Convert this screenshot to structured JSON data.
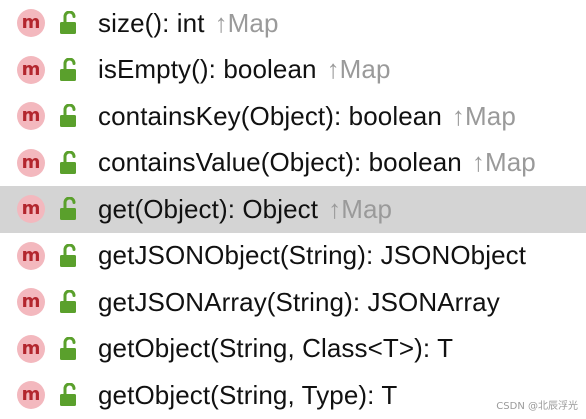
{
  "members": [
    {
      "badge": "m",
      "icon": "open-lock-icon",
      "signature": "size(): int",
      "arrow": "↑",
      "owner": "Map",
      "selected": false
    },
    {
      "badge": "m",
      "icon": "open-lock-icon",
      "signature": "isEmpty(): boolean",
      "arrow": "↑",
      "owner": "Map",
      "selected": false
    },
    {
      "badge": "m",
      "icon": "open-lock-icon",
      "signature": "containsKey(Object): boolean",
      "arrow": "↑",
      "owner": "Map",
      "selected": false
    },
    {
      "badge": "m",
      "icon": "open-lock-icon",
      "signature": "containsValue(Object): boolean",
      "arrow": "↑",
      "owner": "Map",
      "selected": false
    },
    {
      "badge": "m",
      "icon": "open-lock-icon",
      "signature": "get(Object): Object",
      "arrow": "↑",
      "owner": "Map",
      "selected": true
    },
    {
      "badge": "m",
      "icon": "open-lock-icon",
      "signature": "getJSONObject(String): JSONObject",
      "arrow": "",
      "owner": "",
      "selected": false
    },
    {
      "badge": "m",
      "icon": "open-lock-icon",
      "signature": "getJSONArray(String): JSONArray",
      "arrow": "",
      "owner": "",
      "selected": false
    },
    {
      "badge": "m",
      "icon": "open-lock-icon",
      "signature": "getObject(String, Class<T>): T",
      "arrow": "",
      "owner": "",
      "selected": false
    },
    {
      "badge": "m",
      "icon": "open-lock-icon",
      "signature": "getObject(String, Type): T",
      "arrow": "",
      "owner": "",
      "selected": false
    }
  ],
  "watermark": "CSDN @北辰浮光",
  "colors": {
    "badge_bg": "#f3b8be",
    "badge_fg": "#b3262e",
    "lock": "#5aa02c",
    "selected_bg": "#d4d4d4",
    "inherited": "#9a9a9a"
  }
}
